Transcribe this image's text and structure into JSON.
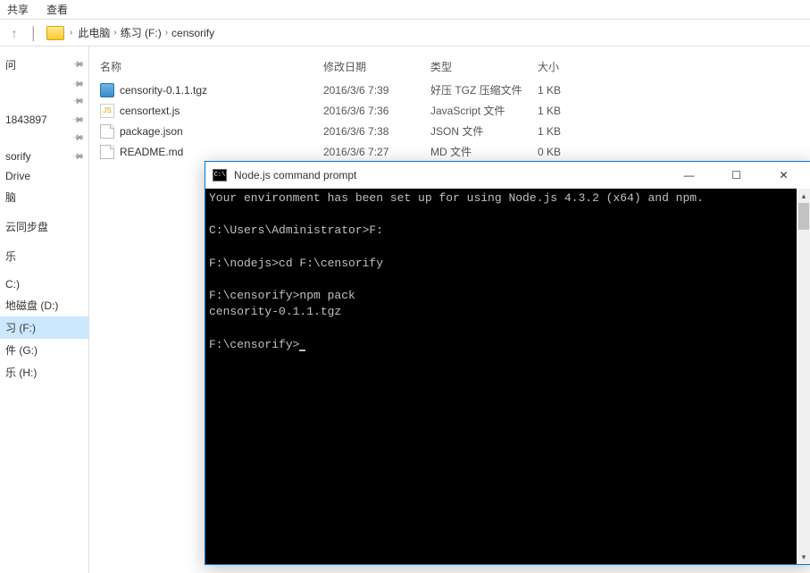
{
  "menu": {
    "share": "共享",
    "view": "查看"
  },
  "breadcrumb": {
    "pc": "此电脑",
    "drive": "练习 (F:)",
    "folder": "censorify"
  },
  "sidebar": {
    "items": [
      {
        "label": "问"
      },
      {
        "label": ""
      },
      {
        "label": ""
      },
      {
        "label": "1843897"
      },
      {
        "label": ""
      },
      {
        "label": "sorify"
      },
      {
        "label": "Drive"
      },
      {
        "label": "脑"
      },
      {
        "label": ""
      },
      {
        "label": "云同步盘"
      },
      {
        "label": ""
      },
      {
        "label": "乐"
      },
      {
        "label": ""
      },
      {
        "label": "C:)"
      },
      {
        "label": "地磁盘 (D:)"
      },
      {
        "label": "习 (F:)",
        "selected": true
      },
      {
        "label": "件 (G:)"
      },
      {
        "label": "乐 (H:)"
      },
      {
        "label": ""
      }
    ]
  },
  "columns": {
    "name": "名称",
    "date": "修改日期",
    "type": "类型",
    "size": "大小"
  },
  "files": [
    {
      "name": "censority-0.1.1.tgz",
      "date": "2016/3/6 7:39",
      "type": "好压 TGZ 压缩文件",
      "size": "1 KB",
      "icon": "archive"
    },
    {
      "name": "censortext.js",
      "date": "2016/3/6 7:36",
      "type": "JavaScript 文件",
      "size": "1 KB",
      "icon": "js"
    },
    {
      "name": "package.json",
      "date": "2016/3/6 7:38",
      "type": "JSON 文件",
      "size": "1 KB",
      "icon": "file"
    },
    {
      "name": "README.md",
      "date": "2016/3/6 7:27",
      "type": "MD 文件",
      "size": "0 KB",
      "icon": "file"
    }
  ],
  "terminal": {
    "title": "Node.js command prompt",
    "lines": [
      "Your environment has been set up for using Node.js 4.3.2 (x64) and npm.",
      "",
      "C:\\Users\\Administrator>F:",
      "",
      "F:\\nodejs>cd F:\\censorify",
      "",
      "F:\\censorify>npm pack",
      "censority-0.1.1.tgz",
      "",
      "F:\\censorify>"
    ]
  }
}
